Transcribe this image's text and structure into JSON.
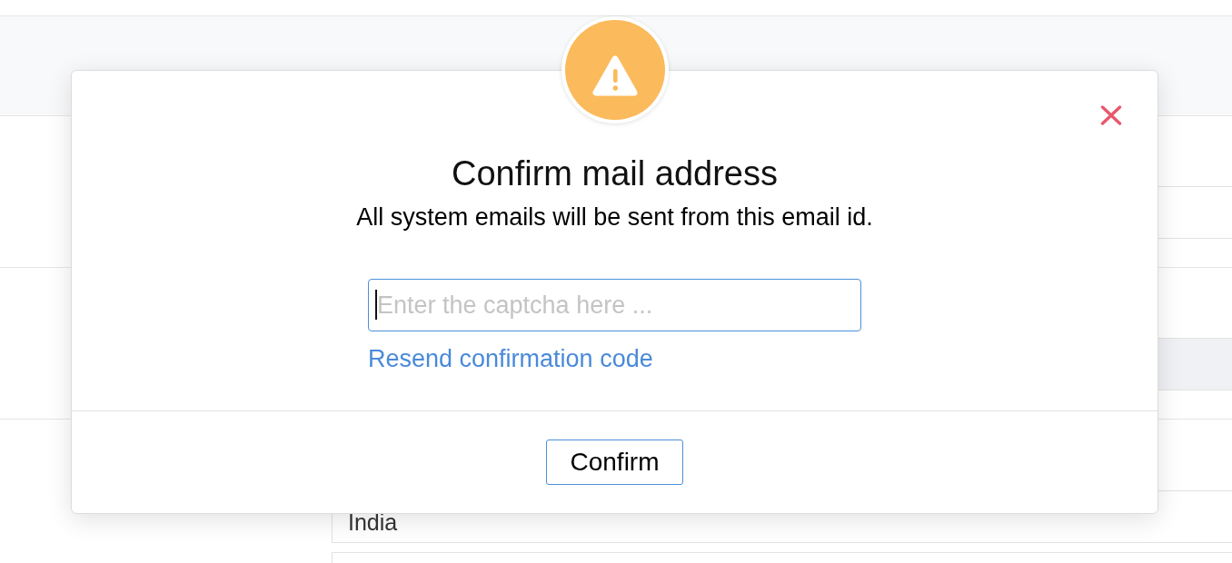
{
  "page": {
    "sections": [
      {
        "fields": [
          {
            "disabled": false
          }
        ]
      },
      {
        "fields": [
          {
            "disabled": true
          }
        ]
      },
      {
        "fields": [
          {
            "disabled": false,
            "value": "India"
          },
          {
            "disabled": false
          }
        ]
      }
    ]
  },
  "dialog": {
    "title": "Confirm mail address",
    "subtitle": "All system emails will be sent from this email id.",
    "captcha_field": {
      "placeholder": "Enter the captcha here ...",
      "focused": true
    },
    "resend_link": "Resend confirmation code",
    "buttons": [
      "Confirm"
    ]
  }
}
